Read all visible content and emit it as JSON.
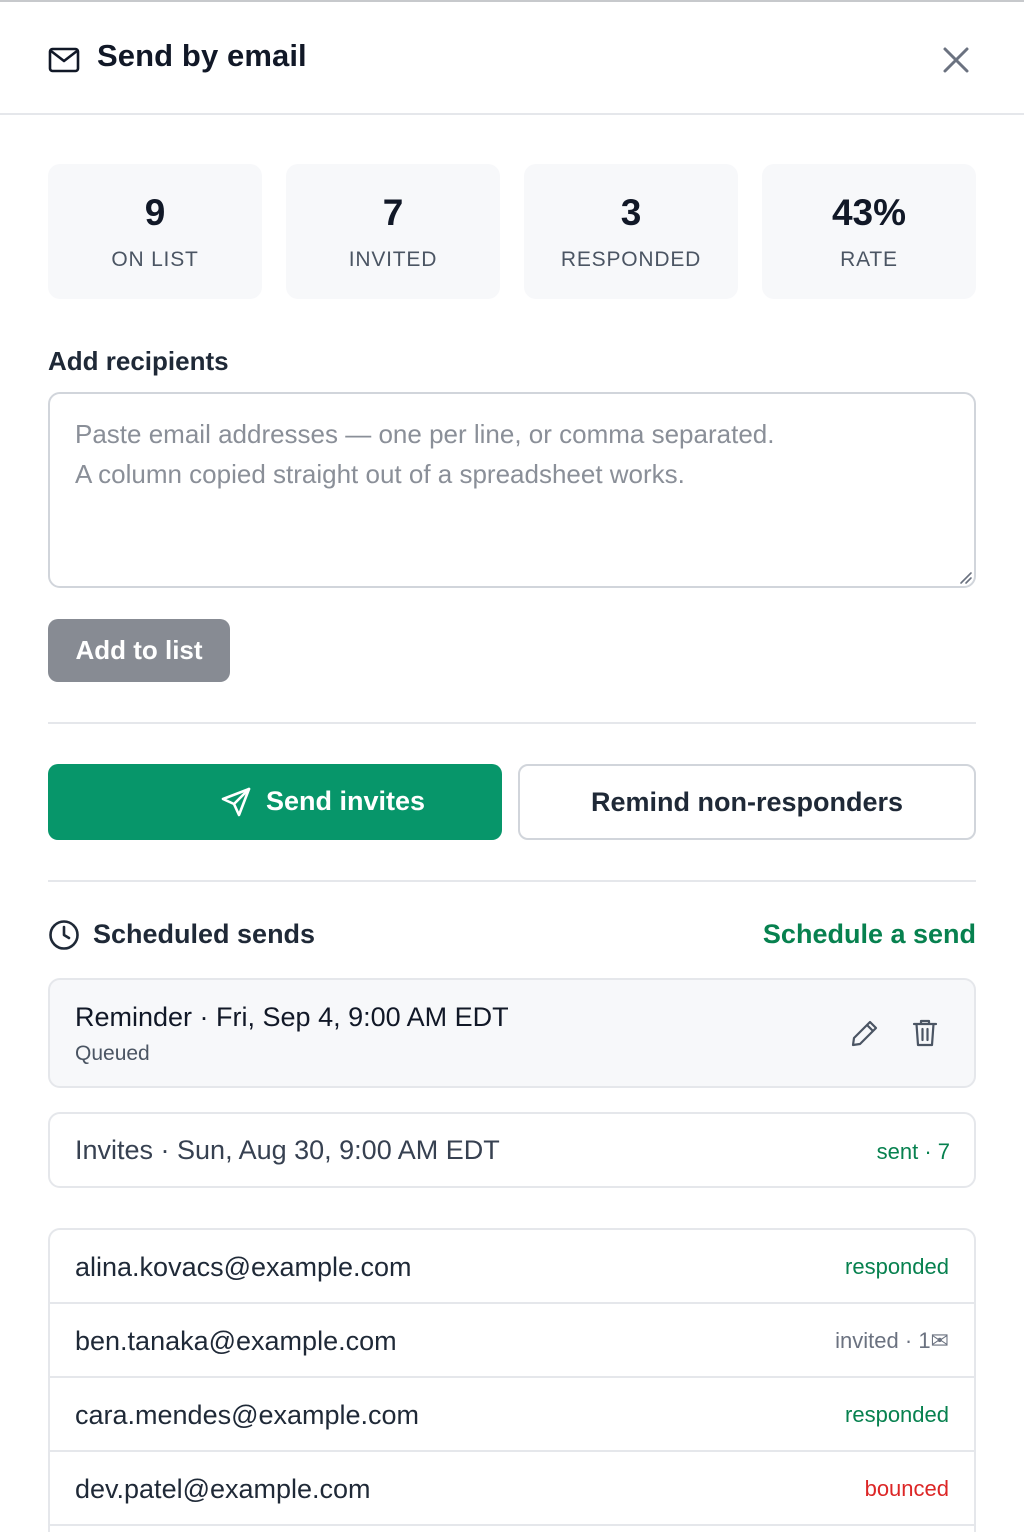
{
  "header": {
    "title": "Send by email"
  },
  "stats": [
    {
      "value": "9",
      "label": "ON LIST"
    },
    {
      "value": "7",
      "label": "INVITED"
    },
    {
      "value": "3",
      "label": "RESPONDED"
    },
    {
      "value": "43%",
      "label": "RATE"
    }
  ],
  "recipients": {
    "label": "Add recipients",
    "placeholder": "Paste email addresses — one per line, or comma separated.\nA column copied straight out of a spreadsheet works.",
    "value": "",
    "add_button": "Add to list"
  },
  "actions": {
    "send_invites": "Send invites",
    "remind": "Remind non-responders"
  },
  "scheduled": {
    "title": "Scheduled sends",
    "schedule_link": "Schedule a send",
    "items": [
      {
        "title": "Reminder · Fri, Sep 4, 9:00 AM EDT",
        "status": "Queued"
      },
      {
        "title": "Invites · Sun, Aug 30, 9:00 AM EDT",
        "status": "sent · 7"
      }
    ]
  },
  "list": [
    {
      "email": "alina.kovacs@example.com",
      "status": "responded",
      "kind": "responded"
    },
    {
      "email": "ben.tanaka@example.com",
      "status": "invited · 1✉",
      "kind": "invited"
    },
    {
      "email": "cara.mendes@example.com",
      "status": "responded",
      "kind": "responded"
    },
    {
      "email": "dev.patel@example.com",
      "status": "bounced",
      "kind": "bounced"
    }
  ],
  "colors": {
    "accent": "#07966a",
    "link": "#07814f",
    "responded": "#07814f",
    "invited": "#6b7280",
    "bounced": "#dc2626",
    "disabled_button": "#878b93"
  },
  "icons": {
    "header": "mail-icon",
    "close": "close-icon",
    "send": "paper-plane-icon",
    "scheduled": "clock-icon",
    "edit": "pencil-icon",
    "delete": "trash-icon"
  }
}
